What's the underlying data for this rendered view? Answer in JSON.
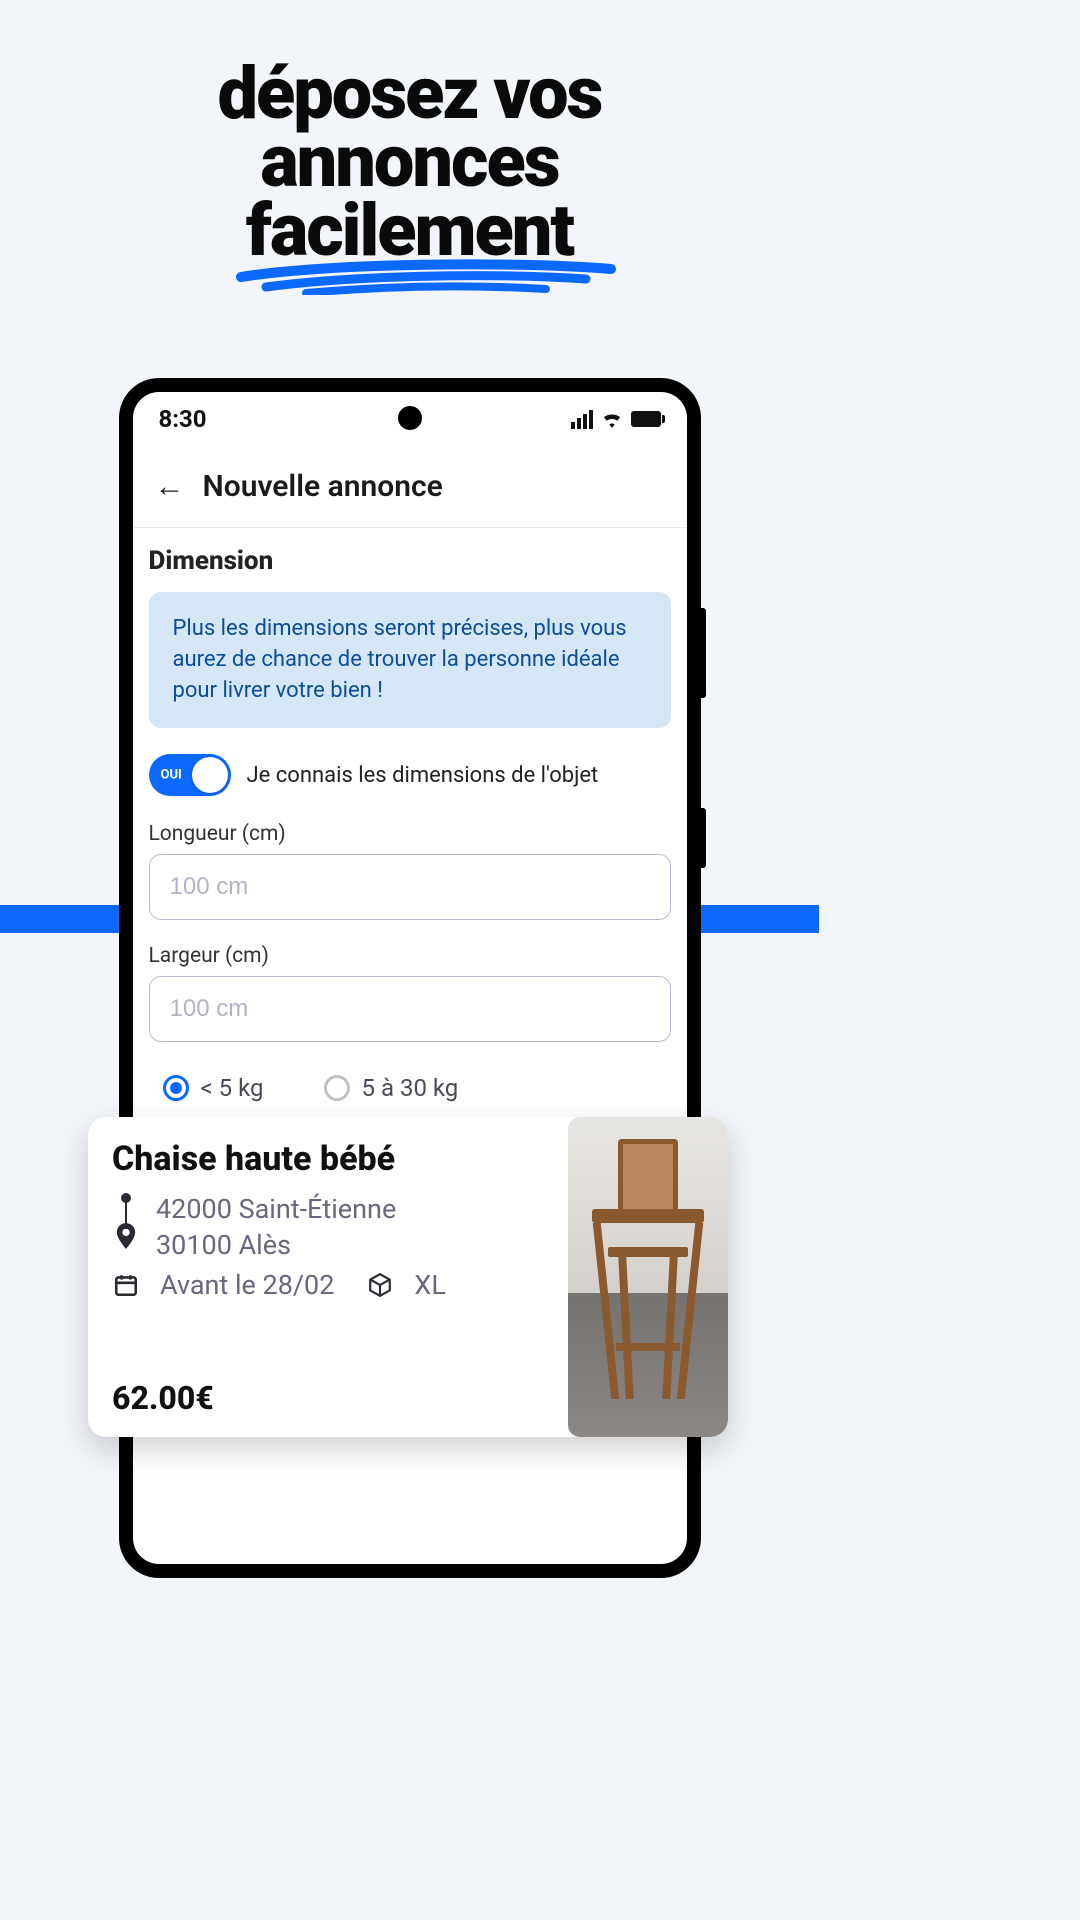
{
  "headline": {
    "line1": "déposez vos",
    "line2": "annonces",
    "line3": "facilement"
  },
  "status": {
    "time": "8:30"
  },
  "header": {
    "title": "Nouvelle annonce"
  },
  "section": {
    "title": "Dimension",
    "hint": "Plus les dimensions seront précises, plus vous aurez de chance de trouver la personne idéale pour livrer votre bien !"
  },
  "toggle": {
    "state_label": "OUI",
    "description": "Je connais les dimensions de l'objet"
  },
  "fields": {
    "length": {
      "label": "Longueur (cm)",
      "placeholder": "100 cm"
    },
    "width": {
      "label": "Largeur (cm)",
      "placeholder": "100 cm"
    }
  },
  "weight": {
    "options": [
      "< 5 kg",
      "5 à 30 kg"
    ]
  },
  "listing": {
    "title": "Chaise haute bébé",
    "origin": "42000 Saint-Étienne",
    "destination": "30100 Alès",
    "deadline": "Avant le 28/02",
    "size": "XL",
    "price": "62.00€"
  },
  "colors": {
    "accent": "#0b69ff"
  }
}
